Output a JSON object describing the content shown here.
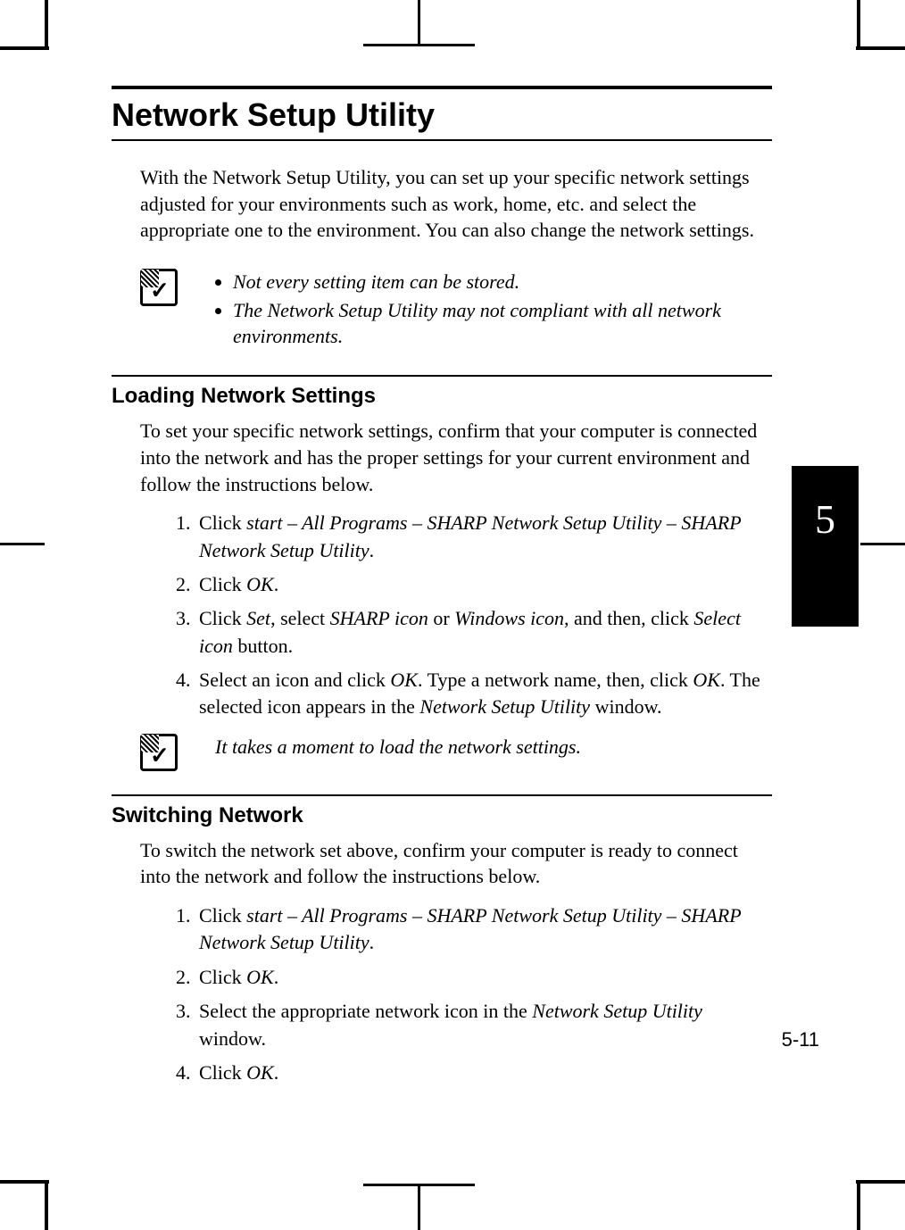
{
  "tab": "5",
  "page_number": "5-11",
  "title": "Network Setup Utility",
  "intro": "With the Network Setup Utility, you can set up your specific network settings adjusted for your environments such as work, home, etc. and select the appropriate one to the environment. You can also change the network settings.",
  "note1": {
    "b1": "Not every setting item can be stored.",
    "b2": "The Network Setup Utility may not compliant with all network environments."
  },
  "section1": {
    "heading": "Loading Network Settings",
    "intro": "To set your specific network settings, confirm that your computer is connected into the network and has the proper settings for your current environment and follow the instructions below.",
    "s1a": "Click ",
    "s1b": "start – All Programs – SHARP Network Setup Utility – SHARP Network Setup Utility",
    "s1c": ".",
    "s2a": "Click ",
    "s2b": "OK",
    "s2c": ".",
    "s3a": "Click ",
    "s3b": "Set",
    "s3c": ", select ",
    "s3d": "SHARP icon",
    "s3e": " or ",
    "s3f": "Windows icon",
    "s3g": ", and then, click ",
    "s3h": "Select icon",
    "s3i": " button.",
    "s4a": "Select an icon and click ",
    "s4b": "OK",
    "s4c": ". Type a network name, then, click ",
    "s4d": "OK",
    "s4e": ". The selected icon appears in the ",
    "s4f": "Network Setup Utility",
    "s4g": " window."
  },
  "note2": "It takes a moment to load the network settings.",
  "section2": {
    "heading": "Switching Network",
    "intro": "To switch the network set above, confirm your computer is ready to connect into the network and follow the instructions below.",
    "s1a": "Click ",
    "s1b": "start – All Programs – SHARP Network Setup Utility – SHARP Network Setup Utility",
    "s1c": ".",
    "s2a": "Click ",
    "s2b": "OK",
    "s2c": ".",
    "s3a": "Select the appropriate network icon in the ",
    "s3b": "Network Setup Utility",
    "s3c": " window.",
    "s4a": "Click ",
    "s4b": "OK",
    "s4c": "."
  }
}
